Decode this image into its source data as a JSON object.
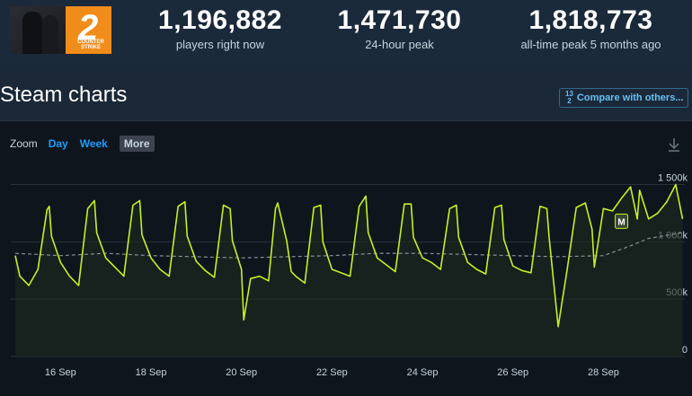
{
  "header": {
    "game_logo_text": "COUNTER STRIKE",
    "game_logo_number": "2",
    "stats": [
      {
        "value": "1,196,882",
        "label": "players right now"
      },
      {
        "value": "1,471,730",
        "label": "24-hour peak"
      },
      {
        "value": "1,818,773",
        "label": "all-time peak 5 months ago"
      }
    ]
  },
  "section": {
    "title": "Steam charts",
    "compare_label": "Compare with others...",
    "compare_icon_top": "1",
    "compare_icon_bottom": "2",
    "compare_icon_mid": "3"
  },
  "zoom": {
    "label": "Zoom",
    "options": [
      "Day",
      "Week",
      "More"
    ],
    "active": "More"
  },
  "chart_data": {
    "type": "line",
    "y_ticks": [
      "0",
      "500k",
      "1 000k",
      "1 500k"
    ],
    "x_ticks": [
      "16 Sep",
      "18 Sep",
      "20 Sep",
      "22 Sep",
      "24 Sep",
      "26 Sep",
      "28 Sep"
    ],
    "ylim": [
      0,
      1500000
    ],
    "marker_label": "M",
    "series": [
      {
        "color": "#c4f21f",
        "x": [
          15.0,
          15.1,
          15.3,
          15.5,
          15.7,
          15.75,
          15.8,
          16.0,
          16.2,
          16.4,
          16.6,
          16.75,
          16.8,
          17.0,
          17.2,
          17.4,
          17.6,
          17.75,
          17.8,
          18.0,
          18.2,
          18.4,
          18.6,
          18.75,
          18.8,
          19.0,
          19.2,
          19.4,
          19.6,
          19.75,
          19.8,
          20.0,
          20.05,
          20.2,
          20.4,
          20.6,
          20.75,
          20.8,
          21.0,
          21.1,
          21.2,
          21.4,
          21.6,
          21.75,
          21.8,
          22.0,
          22.2,
          22.4,
          22.6,
          22.75,
          22.8,
          23.0,
          23.2,
          23.4,
          23.6,
          23.75,
          23.8,
          24.0,
          24.2,
          24.4,
          24.6,
          24.75,
          24.8,
          25.0,
          25.2,
          25.4,
          25.6,
          25.75,
          25.8,
          26.0,
          26.2,
          26.4,
          26.6,
          26.75,
          26.8,
          27.0,
          27.2,
          27.4,
          27.6,
          27.75,
          27.8,
          28.0,
          28.2,
          28.4,
          28.6,
          28.75,
          28.8,
          29.0,
          29.2,
          29.4,
          29.6,
          29.75
        ],
        "y": [
          880000,
          700000,
          620000,
          760000,
          1280000,
          1310000,
          1050000,
          820000,
          700000,
          620000,
          1290000,
          1360000,
          1080000,
          860000,
          780000,
          700000,
          1320000,
          1360000,
          1060000,
          860000,
          760000,
          700000,
          1310000,
          1350000,
          1050000,
          830000,
          750000,
          690000,
          1320000,
          1290000,
          1010000,
          760000,
          320000,
          680000,
          700000,
          660000,
          1290000,
          1340000,
          1010000,
          740000,
          700000,
          640000,
          1300000,
          1320000,
          1000000,
          760000,
          730000,
          700000,
          1310000,
          1400000,
          1080000,
          860000,
          800000,
          740000,
          1330000,
          1330000,
          1040000,
          860000,
          820000,
          760000,
          1290000,
          1320000,
          1040000,
          820000,
          760000,
          720000,
          1300000,
          1320000,
          1020000,
          790000,
          750000,
          730000,
          1310000,
          1290000,
          1040000,
          260000,
          760000,
          1300000,
          1340000,
          1110000,
          780000,
          1290000,
          1270000,
          1380000,
          1480000,
          1200000,
          1450000,
          1200000,
          1250000,
          1350000,
          1500000,
          1200000
        ]
      },
      {
        "color": "#8a8f95",
        "x": [
          15.0,
          16.0,
          17.0,
          18.0,
          19.0,
          20.0,
          21.0,
          22.0,
          23.0,
          24.0,
          25.0,
          26.0,
          27.0,
          28.0,
          28.5,
          29.0,
          29.75
        ],
        "y": [
          900000,
          880000,
          900000,
          880000,
          870000,
          860000,
          870000,
          880000,
          900000,
          900000,
          890000,
          880000,
          870000,
          880000,
          950000,
          1030000,
          1080000
        ]
      }
    ]
  }
}
